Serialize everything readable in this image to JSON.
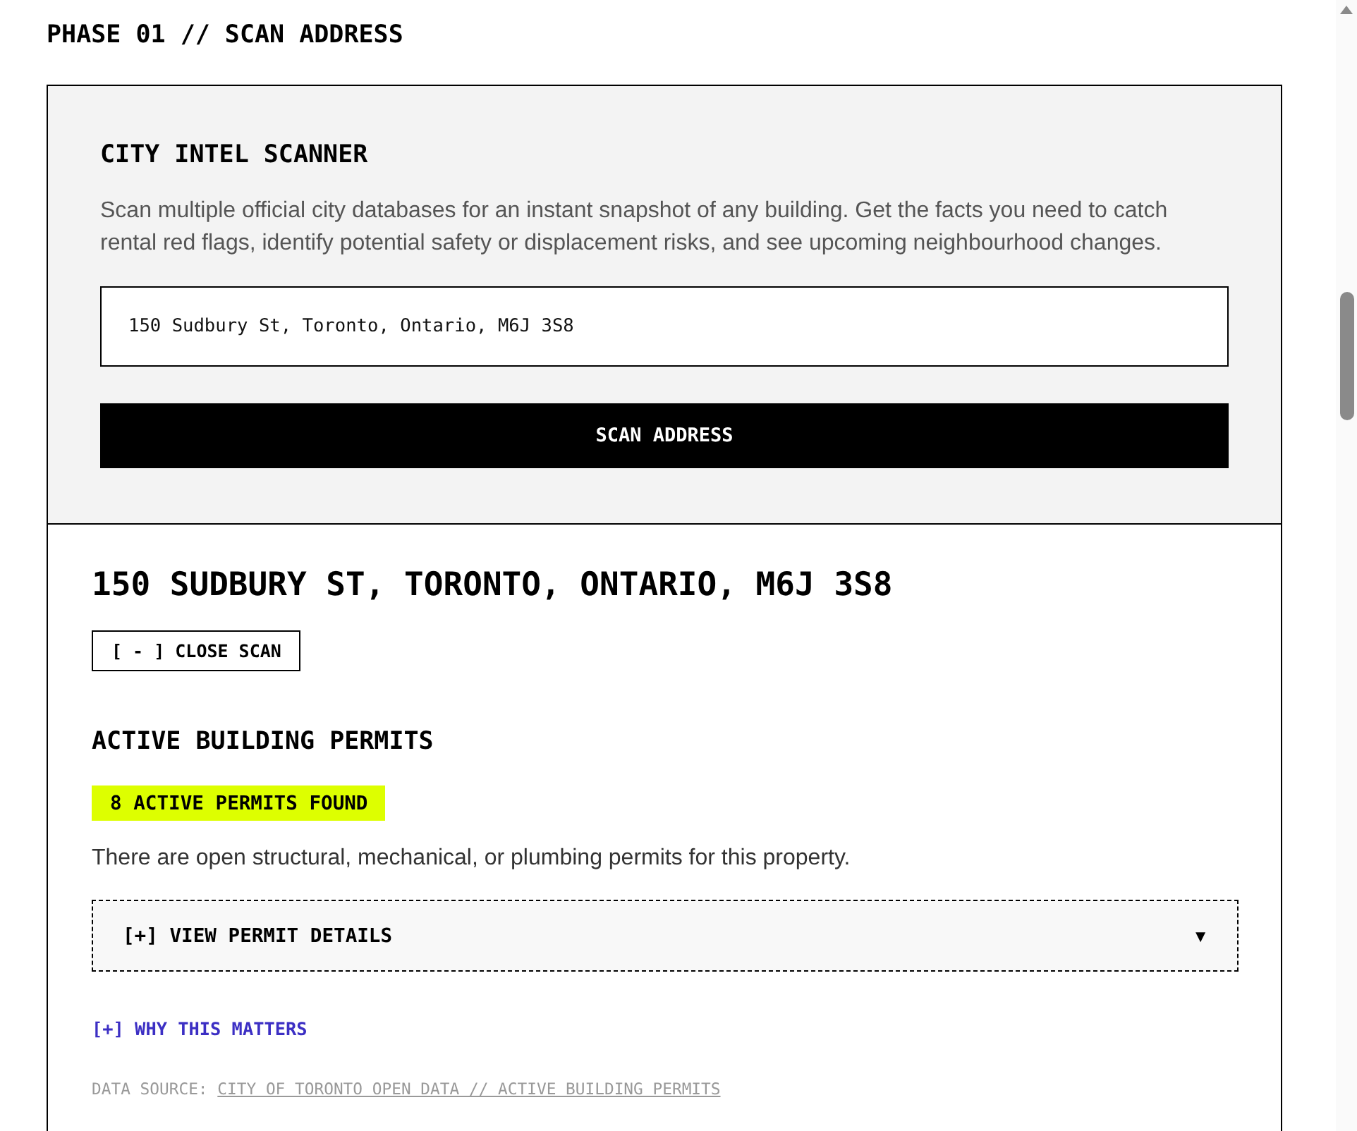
{
  "page": {
    "title": "PHASE 01 // SCAN ADDRESS"
  },
  "scanner": {
    "title": "CITY INTEL SCANNER",
    "description": "Scan multiple official city databases for an instant snapshot of any building. Get the facts you need to catch rental red flags, identify potential safety or displacement risks, and see upcoming neighbourhood changes.",
    "address_field": {
      "value": "150 Sudbury St, Toronto, Ontario, M6J 3S8"
    },
    "submit_button": "SCAN ADDRESS"
  },
  "result": {
    "address": "150 SUDBURY ST, TORONTO, ONTARIO, M6J 3S8",
    "close_button": "[ - ] CLOSE SCAN",
    "sections": [
      {
        "title": "ACTIVE BUILDING PERMITS",
        "badge": "8 ACTIVE PERMITS FOUND",
        "summary": "There are open structural, mechanical, or plumbing permits for this property.",
        "details_toggle": {
          "label": "[+] VIEW PERMIT DETAILS",
          "caret": "▼"
        },
        "why_link": "[+] WHY THIS MATTERS",
        "source": {
          "label": "DATA SOURCE:",
          "link": "CITY OF TORONTO OPEN DATA // ACTIVE BUILDING PERMITS"
        }
      }
    ]
  }
}
